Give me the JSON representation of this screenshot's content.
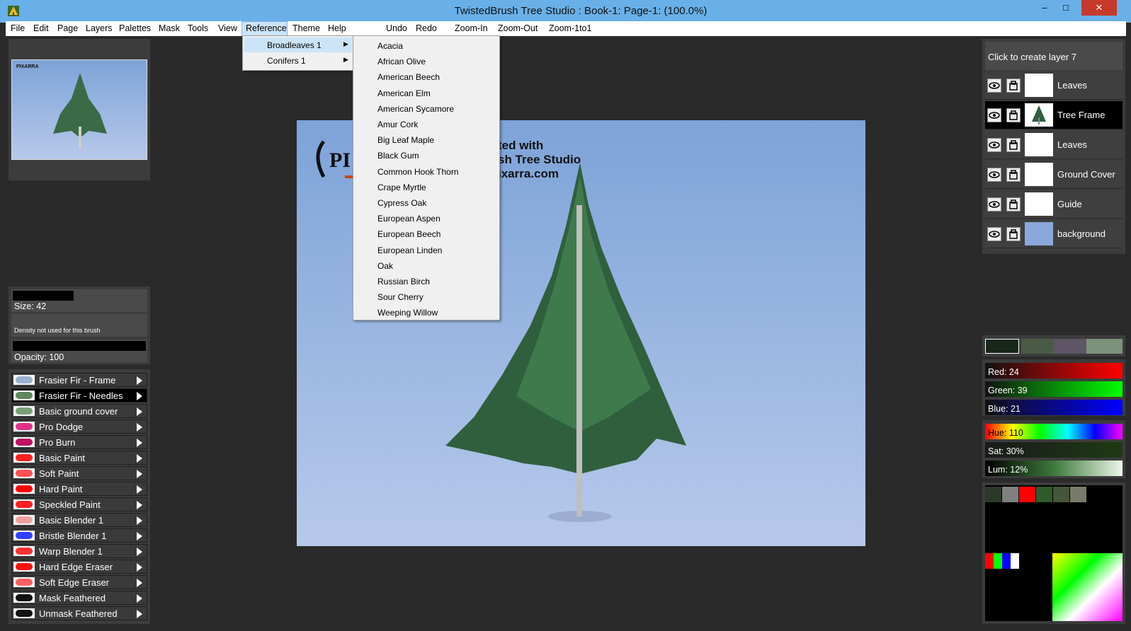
{
  "window": {
    "title": "TwistedBrush Tree Studio : Book-1: Page-1:  (100.0%)",
    "minimize": "–",
    "maximize": "□",
    "close": "✕"
  },
  "menubar": {
    "items": [
      "File",
      "Edit",
      "Page",
      "Layers",
      "Palettes",
      "Mask",
      "Tools",
      "View",
      "Reference",
      "Theme",
      "Help"
    ],
    "actions": [
      "Undo",
      "Redo",
      "Zoom-In",
      "Zoom-Out",
      "Zoom-1to1"
    ]
  },
  "reference_menu": {
    "items": [
      "Broadleaves 1",
      "Conifers 1"
    ]
  },
  "broadleaves_submenu": {
    "items": [
      "Acacia",
      "African Olive",
      "American Beech",
      "American Elm",
      "American Sycamore",
      "Amur Cork",
      "Big Leaf Maple",
      "Black Gum",
      "Common Hook Thorn",
      "Crape Myrtle",
      "Cypress Oak",
      "European Aspen",
      "European Beech",
      "European Linden",
      "Oak",
      "Russian Birch",
      "Sour Cherry",
      "Weeping Willow"
    ]
  },
  "canvas": {
    "caption_lines": [
      "ted with",
      "sh Tree Studio",
      "ixarra.com"
    ],
    "logo_text": "PI",
    "background_top": "#7da3d8",
    "background_bottom": "#b7c9ea"
  },
  "navigator": {
    "logo_text": "PIXARRA"
  },
  "brush_settings": {
    "size": "Size: 42",
    "density": "Density not used for this brush",
    "opacity": "Opacity: 100"
  },
  "brushes": [
    {
      "label": "Frasier Fir - Frame",
      "icon": "fir-frame-icon"
    },
    {
      "label": "Frasier Fir - Needles",
      "icon": "fir-needles-icon"
    },
    {
      "label": "Basic ground cover",
      "icon": "ground-cover-icon"
    },
    {
      "label": "Pro Dodge",
      "icon": "dodge-icon"
    },
    {
      "label": "Pro Burn",
      "icon": "burn-icon"
    },
    {
      "label": "Basic Paint",
      "icon": "paint-icon"
    },
    {
      "label": "Soft Paint",
      "icon": "soft-paint-icon"
    },
    {
      "label": "Hard Paint",
      "icon": "hard-paint-icon"
    },
    {
      "label": "Speckled Paint",
      "icon": "speckled-paint-icon"
    },
    {
      "label": "Basic Blender 1",
      "icon": "blender-icon"
    },
    {
      "label": "Bristle Blender 1",
      "icon": "bristle-blender-icon"
    },
    {
      "label": "Warp Blender 1",
      "icon": "warp-blender-icon"
    },
    {
      "label": "Hard Edge Eraser",
      "icon": "hard-eraser-icon"
    },
    {
      "label": "Soft Edge Eraser",
      "icon": "soft-eraser-icon"
    },
    {
      "label": "Mask Feathered",
      "icon": "mask-icon"
    },
    {
      "label": "Unmask Feathered",
      "icon": "unmask-icon"
    }
  ],
  "layers": {
    "create_label": "Click to create layer 7",
    "items": [
      {
        "name": "Leaves",
        "selected": false
      },
      {
        "name": "Tree Frame",
        "selected": true
      },
      {
        "name": "Leaves",
        "selected": false
      },
      {
        "name": "Ground Cover",
        "selected": false
      },
      {
        "name": "Guide",
        "selected": false
      },
      {
        "name": "background",
        "selected": false
      }
    ]
  },
  "color": {
    "red": "Red: 24",
    "green": "Green: 39",
    "blue": "Blue: 21",
    "hue": "Hue: 110",
    "sat": "Sat: 30%",
    "lum": "Lum: 12%",
    "current": "#18271a",
    "swatches_recent": [
      "#18271a",
      "#4b5a45",
      "#5e5666",
      "#7b927b"
    ],
    "palette_row": [
      "#2a3a28",
      "#808080",
      "#ff0000",
      "#2f5a2a",
      "#46563a",
      "#7a7a6a"
    ]
  }
}
